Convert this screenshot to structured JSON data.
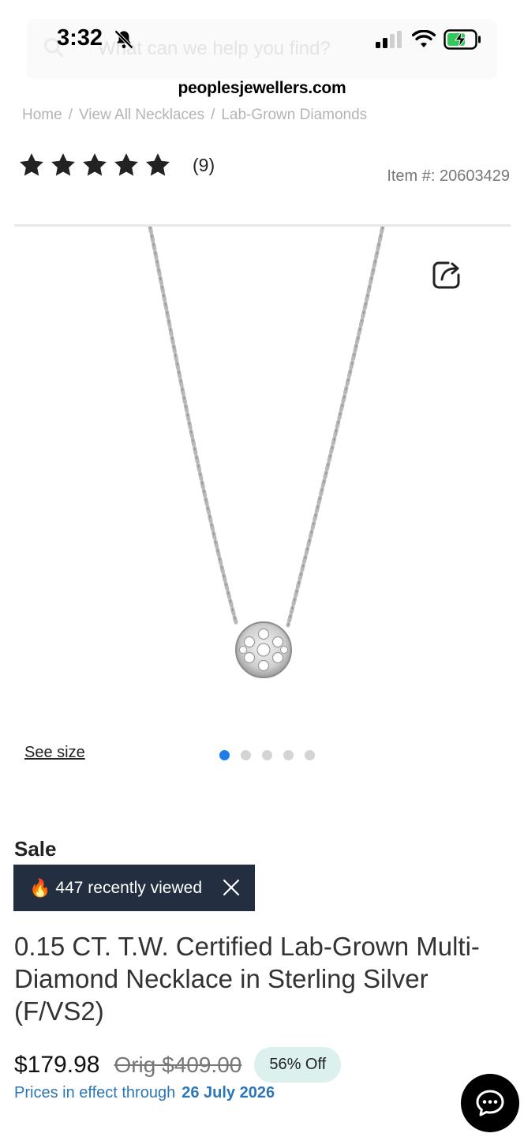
{
  "status_bar": {
    "time": "3:32"
  },
  "search": {
    "placeholder": "What can we help you find?"
  },
  "site": {
    "domain": "peoplesjewellers.com"
  },
  "breadcrumb": [
    "Home",
    "View All Necklaces",
    "Lab-Grown Diamonds"
  ],
  "rating": {
    "stars": 5,
    "count_label": "(9)"
  },
  "item_number": "Item #: 20603429",
  "gallery": {
    "see_size": "See size",
    "image_count": 5,
    "active_index": 0
  },
  "product": {
    "sale_label": "Sale",
    "recently_viewed": "447 recently viewed",
    "title": "0.15 CT. T.W. Certified Lab-Grown Multi-Diamond Necklace in Sterling Silver (F/VS2)",
    "price": "$179.98",
    "original_price": "Orig $409.00",
    "discount": "56% Off",
    "prices_effect_label": "Prices in effect through",
    "prices_effect_date": "26 July 2026"
  },
  "colors": {
    "accent_blue": "#1a7fe6",
    "badge_dark": "#232e40",
    "discount_bg": "#dcf0ee",
    "link_blue": "#2d77b5"
  }
}
